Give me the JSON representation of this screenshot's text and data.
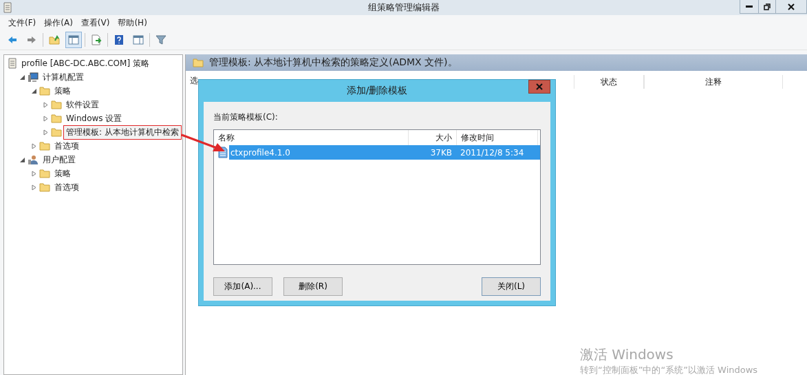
{
  "window": {
    "title": "组策略管理编辑器"
  },
  "menu": [
    "文件(F)",
    "操作(A)",
    "查看(V)",
    "帮助(H)"
  ],
  "tree": [
    {
      "label": "profile [ABC-DC.ABC.COM] 策略",
      "kind": "policy",
      "children": [
        {
          "label": "计算机配置",
          "kind": "computer",
          "expanded": true,
          "children": [
            {
              "label": "策略",
              "kind": "folder",
              "expanded": true,
              "children": [
                {
                  "label": "软件设置",
                  "kind": "folder",
                  "expanded": false
                },
                {
                  "label": "Windows 设置",
                  "kind": "folder",
                  "expanded": false
                },
                {
                  "label": "管理模板: 从本地计算机中检索",
                  "kind": "folder",
                  "expanded": false,
                  "highlighted": true
                }
              ]
            },
            {
              "label": "首选项",
              "kind": "folder",
              "expanded": false
            }
          ]
        },
        {
          "label": "用户配置",
          "kind": "user",
          "expanded": true,
          "children": [
            {
              "label": "策略",
              "kind": "folder",
              "expanded": false
            },
            {
              "label": "首选项",
              "kind": "folder",
              "expanded": false
            }
          ]
        }
      ]
    }
  ],
  "right_pane": {
    "title": "管理模板: 从本地计算机中检索的策略定义(ADMX 文件)。",
    "side_label": "选",
    "columns": [
      "状态",
      "注释"
    ]
  },
  "dialog": {
    "title": "添加/删除模板",
    "label": "当前策略模板(C):",
    "columns": [
      "名称",
      "大小",
      "修改时间"
    ],
    "rows": [
      {
        "name": "ctxprofile4.1.0",
        "size": "37KB",
        "modified": "2011/12/8 5:34",
        "selected": true
      }
    ],
    "buttons": [
      "添加(A)...",
      "删除(R)",
      "关闭(L)"
    ]
  },
  "activation": {
    "title": "激活 Windows",
    "hint": "转到“控制面板”中的“系统”以激活 Windows"
  }
}
